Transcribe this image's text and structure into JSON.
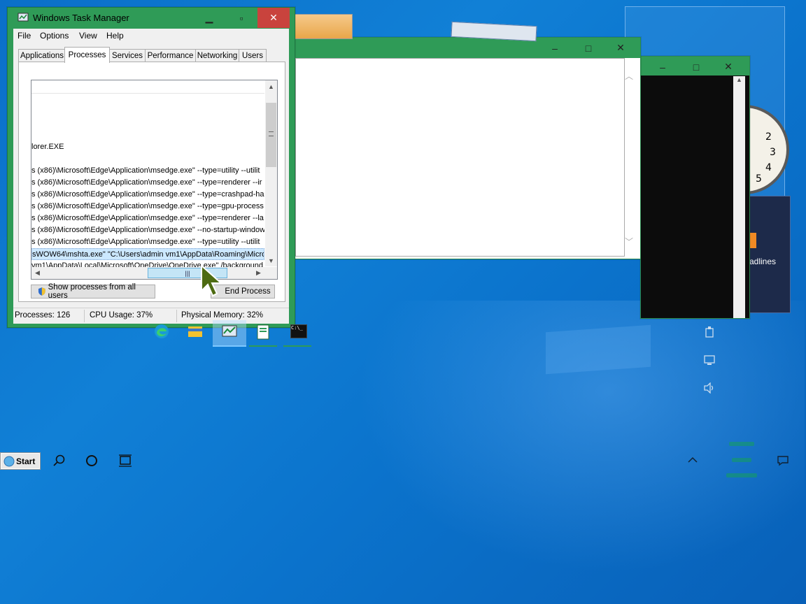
{
  "taskmgr": {
    "title": "Windows Task Manager",
    "menu": [
      "File",
      "Options",
      "View",
      "Help"
    ],
    "tabs": [
      "Applications",
      "Processes",
      "Services",
      "Performance",
      "Networking",
      "Users"
    ],
    "active_tab": "Processes",
    "process_rows": [
      "lorer.EXE",
      "s (x86)\\Microsoft\\Edge\\Application\\msedge.exe\" --type=utility --utilit",
      "s (x86)\\Microsoft\\Edge\\Application\\msedge.exe\" --type=renderer --ir",
      "s (x86)\\Microsoft\\Edge\\Application\\msedge.exe\" --type=crashpad-ha",
      "s (x86)\\Microsoft\\Edge\\Application\\msedge.exe\" --type=gpu-process",
      "s (x86)\\Microsoft\\Edge\\Application\\msedge.exe\" --type=renderer --la",
      "s (x86)\\Microsoft\\Edge\\Application\\msedge.exe\" --no-startup-window",
      "s (x86)\\Microsoft\\Edge\\Application\\msedge.exe\" --type=utility --utilit",
      "sWOW64\\mshta.exe\" \"C:\\Users\\admin vm1\\AppData\\Roaming\\Micros",
      "vm1\\AppData\\Local\\Microsoft\\OneDrive\\OneDrive.exe\" /background"
    ],
    "selected_row_index": 8,
    "show_all_button": "Show processes from all users",
    "end_process_button": "End Process",
    "status": {
      "processes": "Processes: 126",
      "cpu": "CPU Usage: 37%",
      "memory": "Physical Memory: 32%"
    }
  },
  "taskbar": {
    "start_label": "Start",
    "tray_partial_text": "adlines"
  },
  "clock_numbers": [
    "2",
    "3",
    "4",
    "5"
  ],
  "colors": {
    "titlebar": "#2f9b57",
    "desktop": "#0a6fc9",
    "selection": "#cce8ff"
  }
}
